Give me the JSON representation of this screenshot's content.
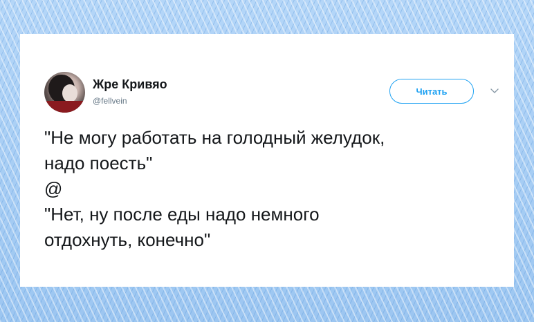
{
  "user": {
    "name": "Жре Кривяо",
    "handle": "@fellvein"
  },
  "follow_button": {
    "label": "Читать"
  },
  "icons": {
    "menu": "chevron-down-icon"
  },
  "tweet": {
    "lines": [
      "\"Не могу работать на голодный желудок,",
      "надо поесть\"",
      "@",
      "\"Нет, ну после еды надо немного",
      "отдохнуть, конечно\""
    ]
  },
  "colors": {
    "accent": "#1da1f2",
    "text": "#14171a",
    "muted": "#657786",
    "background": "#a9cdf3"
  }
}
